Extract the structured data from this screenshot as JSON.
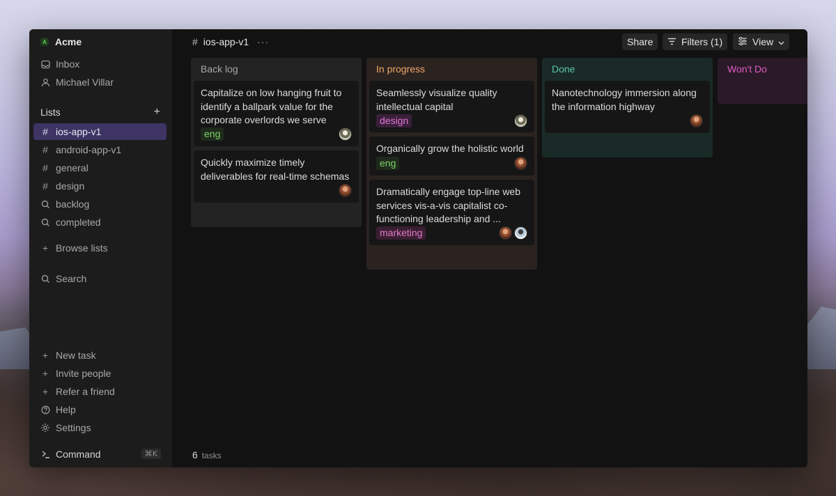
{
  "workspace": {
    "badge": "A",
    "name": "Acme"
  },
  "sidebar": {
    "top_items": [
      {
        "label": "Inbox",
        "icon": "inbox-icon"
      },
      {
        "label": "Michael Villar",
        "icon": "user-icon"
      }
    ],
    "lists_header": "Lists",
    "lists": [
      {
        "label": "ios-app-v1",
        "icon": "hash-icon",
        "active": true
      },
      {
        "label": "android-app-v1",
        "icon": "hash-icon"
      },
      {
        "label": "general",
        "icon": "hash-icon"
      },
      {
        "label": "design",
        "icon": "hash-icon"
      },
      {
        "label": "backlog",
        "icon": "search-icon"
      },
      {
        "label": "completed",
        "icon": "search-icon"
      }
    ],
    "browse_lists": "Browse lists",
    "search": "Search",
    "bottom_items": [
      {
        "label": "New task",
        "icon": "plus-icon"
      },
      {
        "label": "Invite people",
        "icon": "plus-icon"
      },
      {
        "label": "Refer a friend",
        "icon": "plus-icon"
      },
      {
        "label": "Help",
        "icon": "help-icon"
      },
      {
        "label": "Settings",
        "icon": "gear-icon"
      }
    ],
    "command": {
      "label": "Command",
      "shortcut": "⌘K"
    }
  },
  "header": {
    "title": "ios-app-v1",
    "more": "···",
    "share": "Share",
    "filters": "Filters (1)",
    "view": "View"
  },
  "columns": [
    {
      "title": "Back log",
      "color": "#a8a8a8",
      "bg": "#232323",
      "cards": [
        {
          "text": "Capitalize on low hanging fruit to identify a ballpark value for the corporate overlords we serve",
          "tags": [
            "eng"
          ],
          "avatars": [
            "green"
          ]
        },
        {
          "text": "Quickly maximize timely deliverables for real-time schemas",
          "tags": [],
          "avatars": [
            "brown"
          ]
        }
      ]
    },
    {
      "title": "In progress",
      "color": "#f0a868",
      "bg": "#2a2320",
      "cards": [
        {
          "text": "Seamlessly visualize quality intellectual capital",
          "tags": [
            "design"
          ],
          "avatars": [
            "green"
          ]
        },
        {
          "text": "Organically grow the holistic world",
          "tags": [
            "eng"
          ],
          "avatars": [
            "brown"
          ]
        },
        {
          "text": "Dramatically engage top-line web services vis-a-vis capitalist co-functioning leadership and ...",
          "tags": [
            "marketing"
          ],
          "avatars": [
            "brown",
            "light"
          ]
        }
      ]
    },
    {
      "title": "Done",
      "color": "#5cc4a8",
      "bg": "#1a2a27",
      "cards": [
        {
          "text": "Nanotechnology immersion along the information highway",
          "tags": [],
          "avatars": [
            "brown"
          ]
        }
      ]
    },
    {
      "title": "Won't Do",
      "color": "#e05ac8",
      "bg": "#2a1a27",
      "cards": []
    }
  ],
  "footer": {
    "count": "6",
    "label": "tasks"
  }
}
